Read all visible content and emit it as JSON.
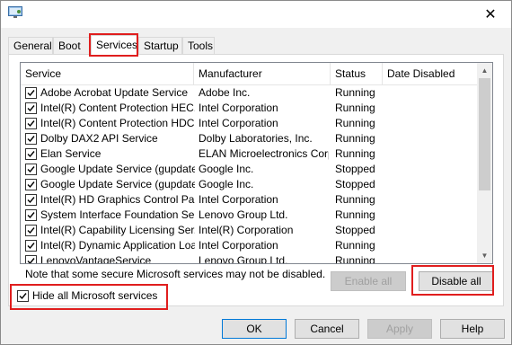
{
  "window": {
    "close_glyph": "✕",
    "app_icon": "msconfig-icon"
  },
  "tabs": [
    {
      "label": "General"
    },
    {
      "label": "Boot"
    },
    {
      "label": "Services"
    },
    {
      "label": "Startup"
    },
    {
      "label": "Tools"
    }
  ],
  "services": {
    "columns": {
      "service": "Service",
      "manufacturer": "Manufacturer",
      "status": "Status",
      "date_disabled": "Date Disabled"
    },
    "rows": [
      {
        "service": "Adobe Acrobat Update Service",
        "manufacturer": "Adobe Inc.",
        "status": "Running",
        "checked": true
      },
      {
        "service": "Intel(R) Content Protection HEC...",
        "manufacturer": "Intel Corporation",
        "status": "Running",
        "checked": true
      },
      {
        "service": "Intel(R) Content Protection HDC...",
        "manufacturer": "Intel Corporation",
        "status": "Running",
        "checked": true
      },
      {
        "service": "Dolby DAX2 API Service",
        "manufacturer": "Dolby Laboratories, Inc.",
        "status": "Running",
        "checked": true
      },
      {
        "service": "Elan Service",
        "manufacturer": "ELAN Microelectronics Corp.",
        "status": "Running",
        "checked": true
      },
      {
        "service": "Google Update Service (gupdate)",
        "manufacturer": "Google Inc.",
        "status": "Stopped",
        "checked": true
      },
      {
        "service": "Google Update Service (gupdatem)",
        "manufacturer": "Google Inc.",
        "status": "Stopped",
        "checked": true
      },
      {
        "service": "Intel(R) HD Graphics Control Pa...",
        "manufacturer": "Intel Corporation",
        "status": "Running",
        "checked": true
      },
      {
        "service": "System Interface Foundation Se...",
        "manufacturer": "Lenovo Group Ltd.",
        "status": "Running",
        "checked": true
      },
      {
        "service": "Intel(R) Capability Licensing Ser...",
        "manufacturer": "Intel(R) Corporation",
        "status": "Stopped",
        "checked": true
      },
      {
        "service": "Intel(R) Dynamic Application Loa...",
        "manufacturer": "Intel Corporation",
        "status": "Running",
        "checked": true
      },
      {
        "service": "LenovoVantageService",
        "manufacturer": "Lenovo Group Ltd.",
        "status": "Running",
        "checked": true
      }
    ]
  },
  "note": "Note that some secure Microsoft services may not be disabled.",
  "buttons": {
    "enable_all": "Enable all",
    "disable_all": "Disable all",
    "ok": "OK",
    "cancel": "Cancel",
    "apply": "Apply",
    "help": "Help"
  },
  "hide_ms": {
    "label": "Hide all Microsoft services",
    "checked": true
  },
  "colors": {
    "highlight": "#e01e1e",
    "accent": "#0078d7"
  }
}
